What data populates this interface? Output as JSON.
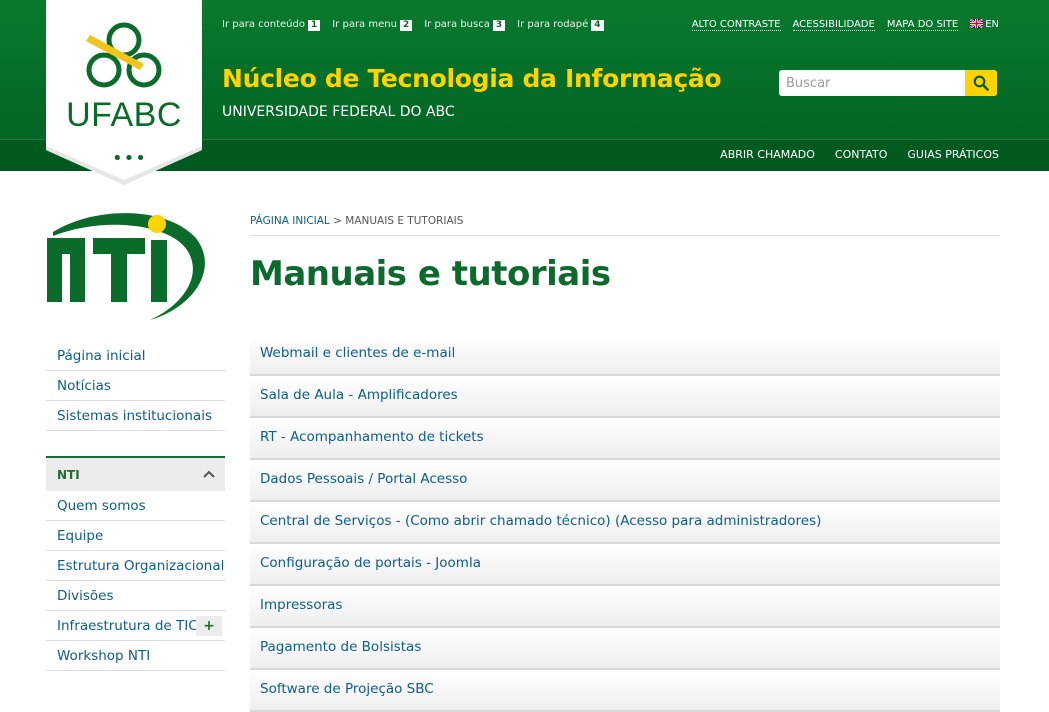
{
  "header": {
    "skip_links": [
      {
        "label": "Ir para conteúdo",
        "key": "1"
      },
      {
        "label": "Ir para menu",
        "key": "2"
      },
      {
        "label": "Ir para busca",
        "key": "3"
      },
      {
        "label": "Ir para rodapé",
        "key": "4"
      }
    ],
    "util_links": {
      "contrast": "ALTO CONTRASTE",
      "accessibility": "ACESSIBILIDADE",
      "sitemap": "MAPA DO SITE",
      "language": "EN"
    },
    "logo_text": "UFABC",
    "logo_dots": "•••",
    "site_title": "Núcleo de Tecnologia da Informação",
    "site_subtitle": "UNIVERSIDADE FEDERAL DO ABC",
    "search": {
      "placeholder": "Buscar"
    },
    "main_nav": [
      "ABRIR CHAMADO",
      "CONTATO",
      "GUIAS PRÁTICOS"
    ]
  },
  "sidebar": {
    "logo_text": "NTI",
    "menu": [
      "Página inicial",
      "Notícias",
      "Sistemas institucionais"
    ],
    "section": {
      "title": "NTI",
      "items": [
        "Quem somos",
        "Equipe",
        "Estrutura Organizacional",
        "Divisões",
        "Infraestrutura de TIC",
        "Workshop NTI"
      ],
      "expand_label": "+"
    }
  },
  "content": {
    "breadcrumb": {
      "home": "PÁGINA INICIAL",
      "separator": " > ",
      "current": "MANUAIS E TUTORIAIS"
    },
    "title": "Manuais e tutoriais",
    "items": [
      "Webmail e clientes de e-mail",
      "Sala de Aula - Amplificadores",
      "RT - Acompanhamento de tickets",
      "Dados Pessoais / Portal Acesso",
      "Central de Serviços - (Como abrir chamado técnico) (Acesso para administradores)",
      "Configuração de portais - Joomla",
      "Impressoras",
      "Pagamento de Bolsistas",
      "Software de Projeção SBC"
    ]
  },
  "colors": {
    "header_green": "#046b27",
    "title_yellow": "#ffd200",
    "link_blue": "#0b5d8e",
    "heading_green": "#0d6a2d"
  }
}
